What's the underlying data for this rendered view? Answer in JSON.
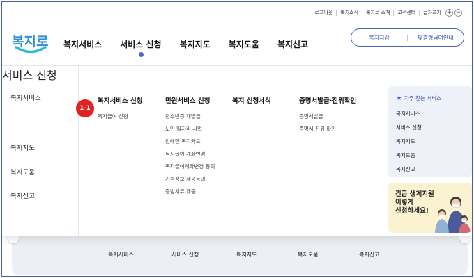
{
  "utility": {
    "links": [
      "로그아웃",
      "복지소식",
      "복지로 소개",
      "고객센터"
    ],
    "font_size_label": "글자크기",
    "font_plus": "+",
    "font_minus": "−"
  },
  "logo": {
    "text": "복지로"
  },
  "gnb": {
    "items": [
      "복지서비스",
      "서비스 신청",
      "복지지도",
      "복지도움",
      "복지신고"
    ],
    "active_index": 1
  },
  "header_pill": {
    "left": "복지지갑",
    "right": "맞춤형급여안내"
  },
  "side_menu": {
    "items": [
      "복지서비스",
      "서비스 신청",
      "복지지도",
      "복지도움",
      "복지신고"
    ],
    "active": "서비스 신청",
    "badge": "1-1"
  },
  "columns": [
    {
      "title": "복지서비스 신청",
      "links": [
        "복지급여 신청"
      ]
    },
    {
      "title": "민원서비스 신청",
      "links": [
        "청소년증 재발급",
        "노인 일자리 사업",
        "장애인 복지카드",
        "복지급여 계좌변경",
        "복지급여계좌변경 동의",
        "가족정보 제공동의",
        "증빙서류 제출"
      ]
    },
    {
      "title": "복지 신청서식",
      "links": []
    },
    {
      "title": "증명서발급·진위확인",
      "links": [
        "증명서발급",
        "증명서 진위 확인"
      ]
    }
  ],
  "favorites": {
    "title": "자주 찾는 서비스",
    "items": [
      "복지서비스",
      "서비스 신청",
      "복지지도",
      "복지도움",
      "복지신고"
    ]
  },
  "promo": {
    "lines": [
      "긴급 생계지원",
      "이렇게",
      "신청하세요!"
    ]
  },
  "bottom_nav": {
    "items": [
      "복지서비스",
      "서비스 신청",
      "복지지도",
      "복지도움",
      "복지신고"
    ]
  },
  "colors": {
    "accent": "#4b5fd6",
    "badge": "#e02222",
    "logo": "#2f8fd6",
    "promo_bg": "#fbf2d2",
    "fav_bg": "#eef1f7"
  }
}
